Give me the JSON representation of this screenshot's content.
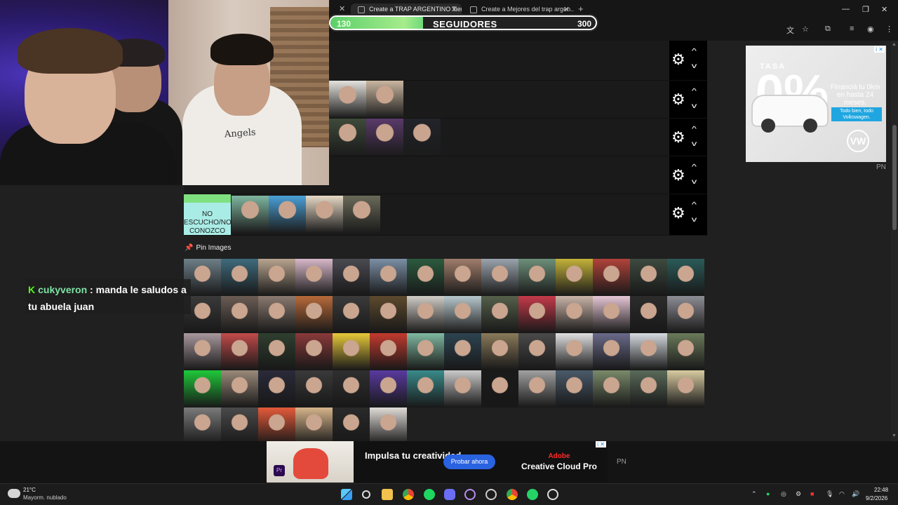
{
  "browser": {
    "tabs": [
      {
        "label": "Create a TRAP ARGENTINO Tier..."
      },
      {
        "label": "Create a Mejores del trap argen..."
      }
    ],
    "new_tab_label": "+",
    "close_glyph": "✕"
  },
  "follower_goal": {
    "min": "130",
    "label": "SEGUIDORES",
    "max": "300",
    "fill_fraction": 0.35
  },
  "webcam": {
    "shirt_text": "Angels"
  },
  "tierlist": {
    "rows": [
      {
        "label": "",
        "tiles": 0
      },
      {
        "label": "",
        "tiles": 2
      },
      {
        "label": "",
        "tiles": 3
      },
      {
        "label": "",
        "tiles": 0
      },
      {
        "label": "NO ESCUCHO/NO CONOZCO",
        "tiles": 4
      }
    ],
    "gear_glyph": "⚙",
    "up_glyph": "^",
    "down_glyph": "v"
  },
  "pin_images": {
    "title": "Pin Images",
    "count": 62,
    "tile_colors": [
      "#6e7f88",
      "#3f6b7d",
      "#b8a48f",
      "#d7b7c9",
      "#4a4a52",
      "#7b8fa5",
      "#2b5a3e",
      "#a07d6b",
      "#9aa3ad",
      "#6d8f79",
      "#c4b23a",
      "#b1433a",
      "#3d4a3f",
      "#2a5b59",
      "#3a3a3a",
      "#6b5d55",
      "#8a7a70",
      "#b86a3a",
      "#3b3b3b",
      "#5d4a2e",
      "#d0ccc6",
      "#b7c7cc",
      "#55604a",
      "#c43a4a",
      "#c9b4a8",
      "#e6c7d6",
      "#2c2c2c",
      "#8d8d95",
      "#a8989e",
      "#c24a4a",
      "#2f3f2f",
      "#8a3a3a",
      "#e7c93a",
      "#c23a2e",
      "#7fb8a0",
      "#2d4450",
      "#8a7a5a",
      "#4a4a4a",
      "#e0e0e0",
      "#6a6a8a",
      "#d6dbe0",
      "#6b7a5a",
      "#1fc93a",
      "#9a8a7a",
      "#2a2a3a",
      "#3a3a3a",
      "#2f2f2f",
      "#5a3aa0",
      "#3a8a8a",
      "#c9c9c9",
      "#1a1a1a",
      "#a0a0a0",
      "#4a5a6a",
      "#7a8a6a",
      "#5a6a5a",
      "#d8cba0",
      "#7a7a7a",
      "#4a4a4a",
      "#e45a3a",
      "#d6b48a",
      "#2a2a2a",
      "#e0dcd8"
    ]
  },
  "chat": {
    "username": "cukyveron",
    "separator": " : ",
    "message": "manda le saludos a tu abuela juan",
    "platform_glyph": "K"
  },
  "ad_right": {
    "rate_label": "TASA",
    "rate_value": "0%",
    "copy": "Financiá tu 0km en hasta 24 meses.",
    "badge": "Todo bien, todo Volkswagen.",
    "logo": "VW",
    "pn": "PN"
  },
  "ad_bottom": {
    "headline": "Impulsa tu creatividad",
    "cta": "Probar ahora",
    "brand_top": "Adobe",
    "brand": "Creative Cloud Pro",
    "pn": "PN",
    "product_glyph": "Pr"
  },
  "taskbar": {
    "temperature": "21°C",
    "weather": "Mayorm. nublado",
    "time": "22:48",
    "date": "9/2/2026"
  },
  "colors": {
    "goal_fill": "#7fe07f",
    "tier_label": "#a9ece6",
    "accent_pin": "#e45a6b"
  }
}
